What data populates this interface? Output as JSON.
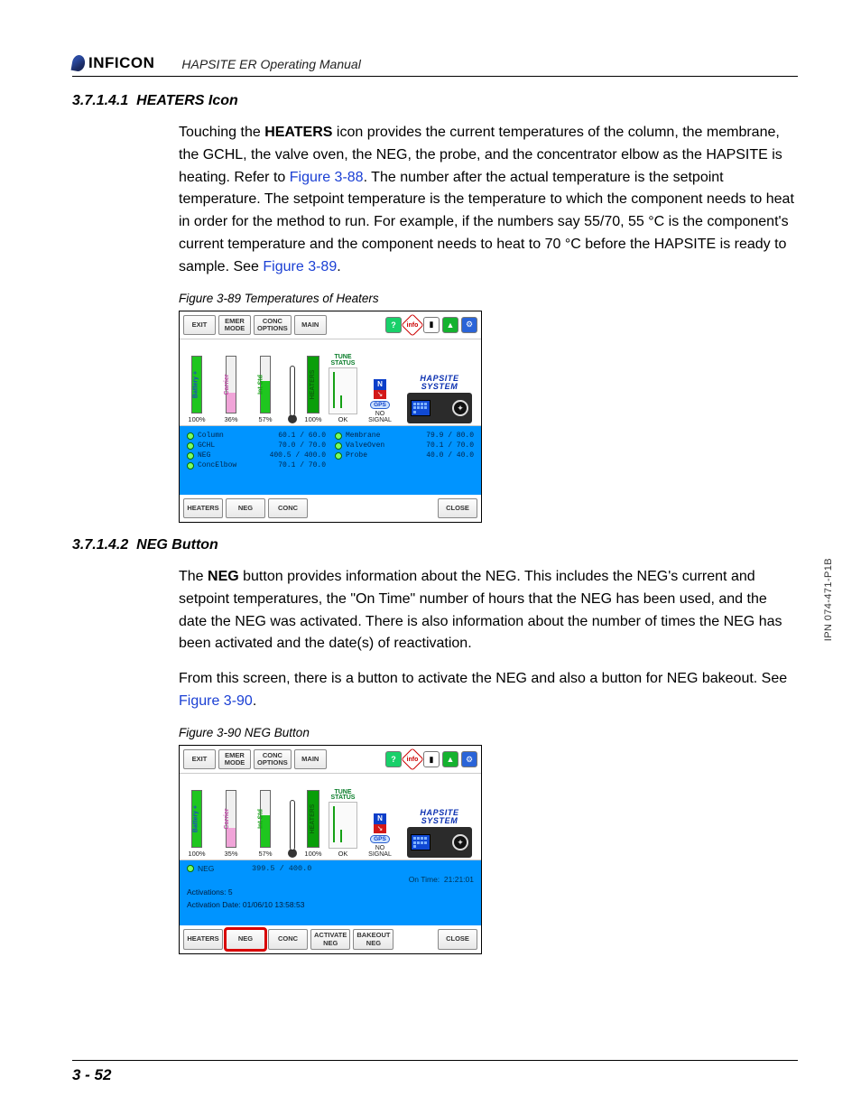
{
  "header": {
    "brand": "INFICON",
    "subtitle": "HAPSITE ER Operating Manual"
  },
  "section1": {
    "number": "3.7.1.4.1",
    "title": "HEATERS Icon",
    "para_pre": "Touching the ",
    "para_bold1": "HEATERS",
    "para_mid1": " icon provides the current temperatures of the column, the membrane, the GCHL, the valve oven, the NEG, the probe, and the concentrator elbow as the HAPSITE is heating. Refer to ",
    "link1": "Figure 3-88",
    "para_mid2": ". The number after the actual temperature is the setpoint temperature. The setpoint temperature is the temperature to which the component needs to heat in order for the method to run. For example, if the numbers say 55/70, 55 °C is the component's current temperature and the component needs to heat to 70 °C before the HAPSITE is ready to sample. See ",
    "link2": "Figure 3-89",
    "para_end": "."
  },
  "figure1_caption": "Figure 3-89  Temperatures of Heaters",
  "toolbar": {
    "exit": "EXIT",
    "emer1": "EMER",
    "emer2": "MODE",
    "conc1": "CONC",
    "conc2": "OPTIONS",
    "main": "MAIN",
    "info_label": "info"
  },
  "gauges": {
    "battery_label": "Battery +",
    "battery_val": "100%",
    "carrier_label": "Carrier",
    "carrier_val1": "36%",
    "carrier_val2": "35%",
    "intstd_label": "Int Std",
    "intstd_val": "57%",
    "heaters_label": "HEATERS",
    "heaters_val": "100%",
    "tune1": "TUNE",
    "tune2": "STATUS",
    "ok": "OK",
    "gps": "GPS",
    "no": "NO",
    "signal": "SIGNAL",
    "hapsite1": "HAPSITE",
    "hapsite2": "SYSTEM",
    "n": "N"
  },
  "heaters_data": {
    "left": [
      {
        "name": "Column",
        "val": "60.1 /   60.0"
      },
      {
        "name": "GCHL",
        "val": "70.0 /   70.0"
      },
      {
        "name": "NEG",
        "val": "400.5 / 400.0"
      },
      {
        "name": "ConcElbow",
        "val": "70.1 /   70.0"
      }
    ],
    "right": [
      {
        "name": "Membrane",
        "val": "79.9 /   80.0"
      },
      {
        "name": "ValveOven",
        "val": "70.1 /   70.0"
      },
      {
        "name": "Probe",
        "val": "40.0 /   40.0"
      }
    ]
  },
  "footer1": {
    "heaters": "HEATERS",
    "neg": "NEG",
    "conc": "CONC",
    "close": "CLOSE"
  },
  "section2": {
    "number": "3.7.1.4.2",
    "title": "NEG Button",
    "p1_pre": "The ",
    "p1_bold": "NEG",
    "p1_rest": " button provides information about the NEG. This includes the NEG's current and setpoint temperatures, the \"On Time\" number of hours that the NEG has been used, and the date the NEG was activated. There is also information about the number of times the NEG has been activated and the date(s) of reactivation.",
    "p2_pre": "From this screen, there is a button to activate the NEG and also a button for NEG bakeout. See ",
    "p2_link": "Figure 3-90",
    "p2_end": "."
  },
  "figure2_caption": "Figure 3-90  NEG Button",
  "neg_data": {
    "label": "NEG",
    "temp": "399.5 / 400.0",
    "ontime_lbl": "On Time:",
    "ontime_val": "21:21:01",
    "activations": "Activations: 5",
    "activation_date": "Activation Date: 01/06/10 13:58:53"
  },
  "footer2": {
    "heaters": "HEATERS",
    "neg": "NEG",
    "conc": "CONC",
    "activate1": "ACTIVATE",
    "activate2": "NEG",
    "bakeout1": "BAKEOUT",
    "bakeout2": "NEG",
    "close": "CLOSE"
  },
  "page_number": "3 - 52",
  "side_ipn": "IPN 074-471-P1B"
}
